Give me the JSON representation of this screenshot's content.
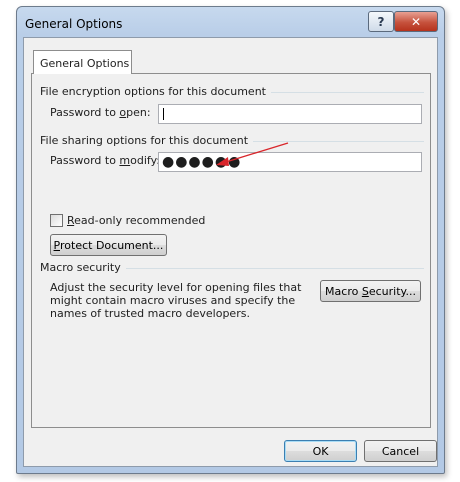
{
  "window": {
    "title": "General Options",
    "help_label": "?",
    "close_label": "✕"
  },
  "tab": {
    "label": "General Options"
  },
  "encryption": {
    "header": "File encryption options for this document",
    "password_open_label_pre": "Password to ",
    "password_open_label_key": "o",
    "password_open_label_post": "pen:",
    "password_open_value": ""
  },
  "sharing": {
    "header": "File sharing options for this document",
    "password_modify_label_pre": "Password to ",
    "password_modify_label_key": "m",
    "password_modify_label_post": "odify:",
    "password_modify_value": "●●●●●●",
    "readonly_label_key": "R",
    "readonly_label_post": "ead-only recommended",
    "readonly_checked": false,
    "protect_label_key": "P",
    "protect_label_post": "rotect Document..."
  },
  "macro": {
    "header": "Macro security",
    "description": "Adjust the security level for opening files that might contain macro viruses and specify the names of trusted macro developers.",
    "button_label_pre": "Macro ",
    "button_label_key": "S",
    "button_label_post": "ecurity..."
  },
  "footer": {
    "ok_label": "OK",
    "cancel_label": "Cancel"
  },
  "annotation": {
    "arrow_color": "#d9262b",
    "icon": "red-arrow-icon"
  }
}
